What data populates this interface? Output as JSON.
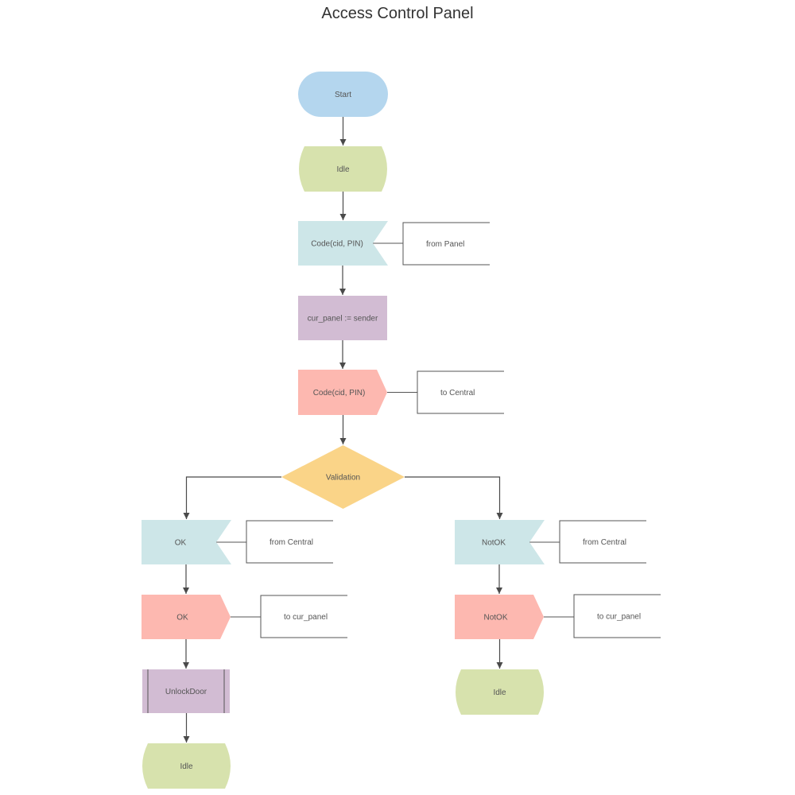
{
  "title": "Access Control Panel",
  "colors": {
    "terminal": "#b4d6ee",
    "state": "#d7e2ad",
    "receive": "#cde6e8",
    "task": "#d2bcd3",
    "send": "#fdb8b0",
    "decision": "#fad488",
    "edge": "#4a4a4a",
    "text": "#555555"
  },
  "nodes": [
    {
      "id": "start",
      "type": "terminal",
      "label": "Start"
    },
    {
      "id": "idle-1",
      "type": "state",
      "label": "Idle"
    },
    {
      "id": "receive-code",
      "type": "receive",
      "label": "Code(cid, PIN)",
      "annotation": "from Panel"
    },
    {
      "id": "assign-panel",
      "type": "task",
      "label": "cur_panel := sender"
    },
    {
      "id": "send-code",
      "type": "send",
      "label": "Code(cid, PIN)",
      "annotation": "to Central"
    },
    {
      "id": "validation",
      "type": "decision",
      "label": "Validation"
    },
    {
      "id": "receive-ok",
      "type": "receive",
      "label": "OK",
      "annotation": "from Central"
    },
    {
      "id": "send-ok",
      "type": "send",
      "label": "OK",
      "annotation": "to cur_panel"
    },
    {
      "id": "unlock-door",
      "type": "procedure",
      "label": "UnlockDoor"
    },
    {
      "id": "idle-ok",
      "type": "state",
      "label": "Idle"
    },
    {
      "id": "receive-notok",
      "type": "receive",
      "label": "NotOK",
      "annotation": "from Central"
    },
    {
      "id": "send-notok",
      "type": "send",
      "label": "NotOK",
      "annotation": "to cur_panel"
    },
    {
      "id": "idle-notok",
      "type": "state",
      "label": "Idle"
    }
  ],
  "edges": [
    {
      "from": "start",
      "to": "idle-1"
    },
    {
      "from": "idle-1",
      "to": "receive-code"
    },
    {
      "from": "receive-code",
      "to": "assign-panel"
    },
    {
      "from": "assign-panel",
      "to": "send-code"
    },
    {
      "from": "send-code",
      "to": "validation"
    },
    {
      "from": "validation",
      "to": "receive-ok"
    },
    {
      "from": "validation",
      "to": "receive-notok"
    },
    {
      "from": "receive-ok",
      "to": "send-ok"
    },
    {
      "from": "send-ok",
      "to": "unlock-door"
    },
    {
      "from": "unlock-door",
      "to": "idle-ok"
    },
    {
      "from": "receive-notok",
      "to": "send-notok"
    },
    {
      "from": "send-notok",
      "to": "idle-notok"
    }
  ]
}
